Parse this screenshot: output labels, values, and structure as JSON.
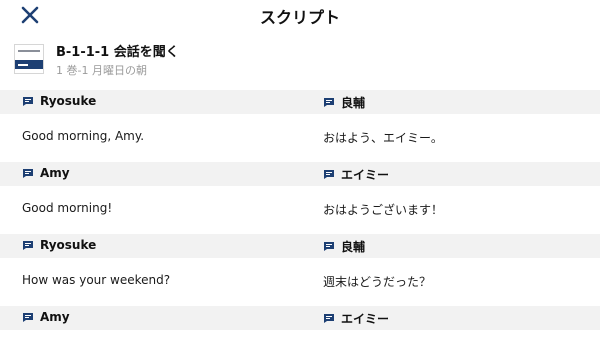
{
  "header": {
    "title": "スクリプト",
    "close_icon": "close-icon"
  },
  "lesson": {
    "title": "B-1-1-1 会話を聞く",
    "subtitle": "1 巻-1 月曜日の朝",
    "thumbnail_icon": "book-cover-thumbnail"
  },
  "colors": {
    "close_icon": "#1d3f73",
    "speaker_row_bg": "#f2f2f2",
    "subtitle_text": "#9b9b9b"
  },
  "script": {
    "rows": [
      {
        "speaker_en": "Ryosuke",
        "speaker_ja": "良輔",
        "text_en": "Good morning, Amy.",
        "text_ja": "おはよう、エイミー。"
      },
      {
        "speaker_en": "Amy",
        "speaker_ja": "エイミー",
        "text_en": "Good morning!",
        "text_ja": "おはようございます！"
      },
      {
        "speaker_en": "Ryosuke",
        "speaker_ja": "良輔",
        "text_en": "How was your weekend?",
        "text_ja": "週末はどうだった？"
      },
      {
        "speaker_en": "Amy",
        "speaker_ja": "エイミー"
      }
    ]
  }
}
